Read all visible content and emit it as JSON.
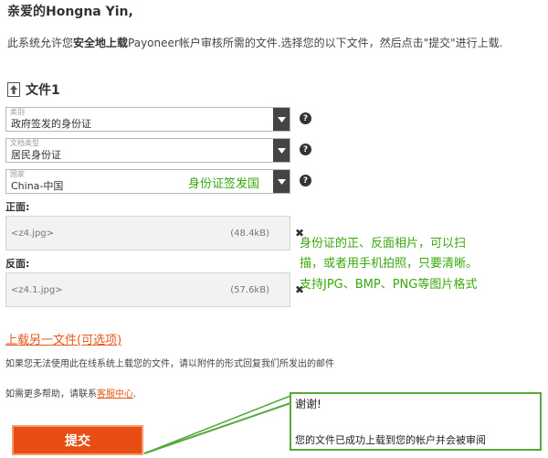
{
  "greeting": "亲爱的Hongna Yin,",
  "intro": {
    "part1": "此系统允许您",
    "bold": "安全地上载",
    "part2": "Payoneer帐户审核所需的文件.选择您的以下文件，然后点击\"提交\"进行上载."
  },
  "file_section": {
    "icon": "upload-icon",
    "title": "文件1"
  },
  "fields": {
    "category": {
      "label": "类别",
      "value": "政府签发的身份证"
    },
    "doc_type": {
      "label": "文档类型",
      "value": "居民身份证"
    },
    "country": {
      "label": "国家",
      "value": "China-中国"
    }
  },
  "help_glyph": "?",
  "annotations": {
    "country_note": "身份证签发国",
    "photo_note_1": "身份证的正、反面相片，可以扫",
    "photo_note_2": "描，或者用手机拍照，只要清晰。",
    "photo_note_3": "支持JPG、BMP、PNG等图片格式"
  },
  "front": {
    "label": "正面:",
    "filename": "<z4.jpg>",
    "size": "(48.4kB)"
  },
  "back": {
    "label": "反面:",
    "filename": "<z4.1.jpg>",
    "size": "(57.6kB)"
  },
  "remove_glyph": "✖",
  "upload_more": "上载另一文件(可选项)",
  "info_text": "如果您无法使用此在线系统上载您的文件，请以附件的形式回复我们所发出的邮件",
  "help": {
    "prefix": "如需更多帮助，请联系",
    "link": "客服中心",
    "suffix": "."
  },
  "submit_label": "提交",
  "popup": {
    "line1": "谢谢!",
    "line2": "您的文件已成功上载到您的帐户并会被审阅"
  },
  "colors": {
    "accent": "#e84d13",
    "note_green": "#3aa80c",
    "popup_border": "#55a83a"
  }
}
